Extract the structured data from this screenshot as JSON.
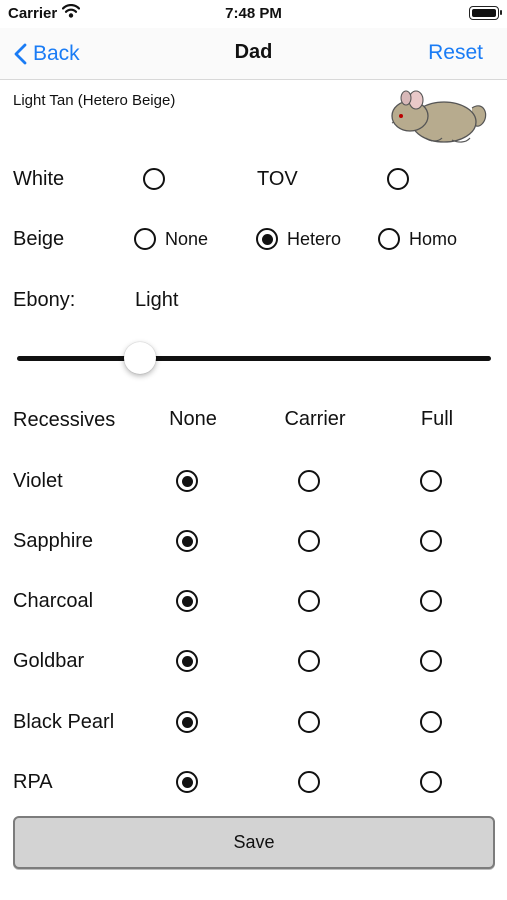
{
  "status": {
    "carrier": "Carrier",
    "time": "7:48 PM"
  },
  "nav": {
    "back": "Back",
    "title": "Dad",
    "reset": "Reset"
  },
  "description": "Light Tan (Hetero Beige)",
  "white": {
    "label": "White",
    "selected": false
  },
  "tov": {
    "label": "TOV",
    "selected": false
  },
  "beige": {
    "label": "Beige",
    "options": [
      {
        "label": "None",
        "selected": false
      },
      {
        "label": "Hetero",
        "selected": true
      },
      {
        "label": "Homo",
        "selected": false
      }
    ]
  },
  "ebony": {
    "label": "Ebony:",
    "value_label": "Light",
    "slider_fraction": 0.26
  },
  "recessives": {
    "header": "Recessives",
    "columns": [
      "None",
      "Carrier",
      "Full"
    ],
    "rows": [
      {
        "label": "Violet",
        "selected": "None"
      },
      {
        "label": "Sapphire",
        "selected": "None"
      },
      {
        "label": "Charcoal",
        "selected": "None"
      },
      {
        "label": "Goldbar",
        "selected": "None"
      },
      {
        "label": "Black Pearl",
        "selected": "None"
      },
      {
        "label": "RPA",
        "selected": "None"
      }
    ]
  },
  "save": "Save",
  "icons": {
    "back": "chevron-left-icon",
    "wifi": "wifi-icon",
    "battery": "battery-icon",
    "animal": "chinchilla-image"
  }
}
